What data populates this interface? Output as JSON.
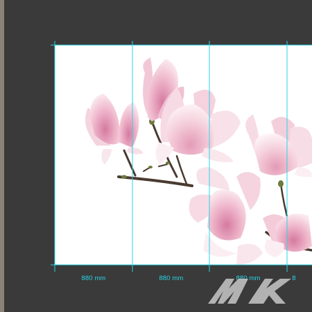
{
  "document": {
    "panel_widths": [
      "880 mm",
      "880 mm",
      "880 mm",
      "8"
    ],
    "guide_color": "#2ad4e4",
    "workspace_color": "#3a3a3a",
    "canvas_color": "#ffffff"
  },
  "artwork": {
    "subject": "pink magnolia branch with blossoms",
    "petal_color": "#f3c9d6",
    "petal_deep_color": "#d987a8",
    "branch_color": "#4a3a30"
  },
  "watermark": {
    "icon": "mk-logo-icon"
  }
}
